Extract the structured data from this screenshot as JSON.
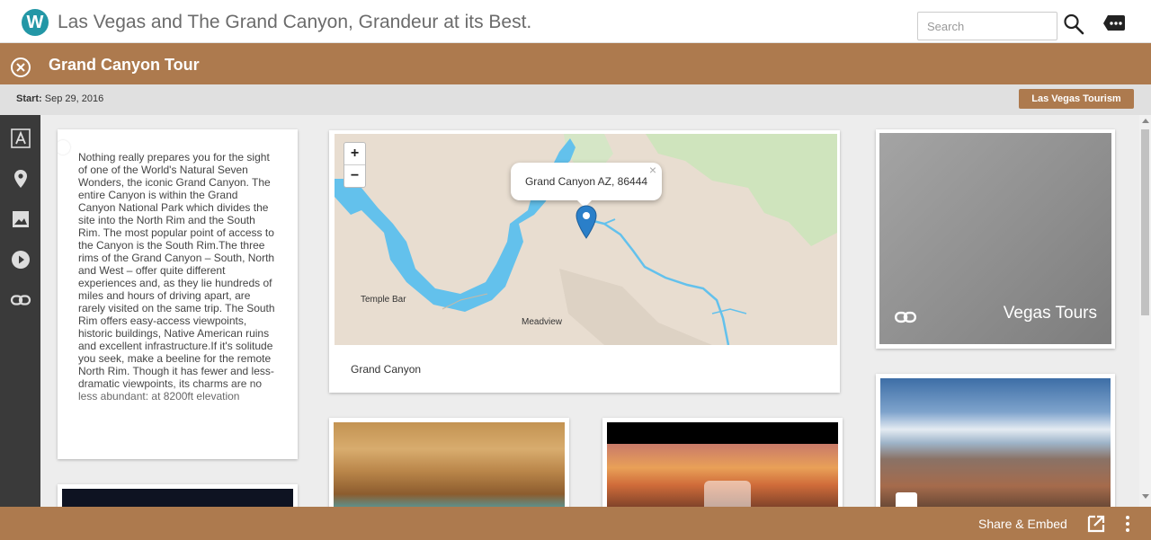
{
  "header": {
    "logo_letter": "W",
    "site_title": "Las Vegas and The Grand Canyon, Grandeur at its Best.",
    "search_placeholder": "Search"
  },
  "tour": {
    "title": "Grand Canyon Tour",
    "start_label": "Start:",
    "start_date": "Sep 29, 2016",
    "tag": "Las Vegas Tourism"
  },
  "sidebar": {
    "icons": [
      "text-icon",
      "map-pin-icon",
      "image-icon",
      "play-icon",
      "link-icon"
    ]
  },
  "cards": {
    "text": "Nothing really prepares you for the sight of one of the World's Natural Seven Wonders, the iconic Grand Canyon. The entire Canyon is within the Grand Canyon National Park which divides the site into the North Rim and the South Rim. The most popular point of access to the Canyon is the South Rim.The three rims of the Grand Canyon – South, North and West – offer quite different experiences and, as they lie hundreds of miles and hours of driving apart, are rarely visited on the same trip. The South Rim offers easy-access viewpoints, historic buildings, Native American ruins and excellent infrastructure.If it's solitude you seek, make a beeline for the remote North Rim. Though it has fewer and less-dramatic viewpoints, its charms are no less abundant: at 8200ft elevation",
    "map": {
      "caption": "Grand Canyon",
      "popup": "Grand Canyon AZ, 86444",
      "zoom_in": "+",
      "zoom_out": "−",
      "place_labels": [
        "Temple Bar",
        "Meadview"
      ]
    },
    "link": {
      "title": "Vegas Tours"
    }
  },
  "footer": {
    "share_label": "Share & Embed"
  },
  "colors": {
    "accent": "#ad7a4e",
    "logo": "#2397a6",
    "sidebar": "#3a3a3a"
  }
}
